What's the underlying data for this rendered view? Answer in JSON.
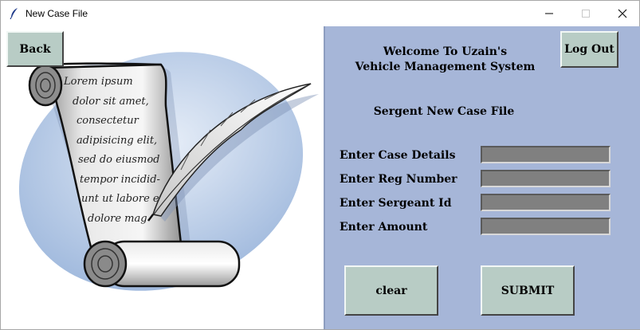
{
  "window": {
    "title": "New Case File",
    "icon": "feather-icon"
  },
  "header": {
    "back_label": "Back",
    "logout_label": "Log Out",
    "welcome_line1": "Welcome To Uzain's",
    "welcome_line2": "Vehicle Management System",
    "subheading": "Sergent New Case File"
  },
  "illustration": {
    "lines": [
      "Lorem ipsum",
      "dolor sit amet,",
      "consectetur",
      "adipisicing elit,",
      "sed do eiusmod",
      "tempor incidid-",
      "unt ut labore e",
      "dolore mag"
    ]
  },
  "form": {
    "fields": [
      {
        "label": "Enter Case Details",
        "value": ""
      },
      {
        "label": "Enter Reg Number",
        "value": ""
      },
      {
        "label": "Enter Sergeant Id",
        "value": ""
      },
      {
        "label": "Enter Amount",
        "value": ""
      }
    ],
    "clear_label": "clear",
    "submit_label": "SUBMIT"
  },
  "colors": {
    "panel_bg": "#a6b6d8",
    "button_bg": "#b8ccc5",
    "field_bg": "#808080"
  }
}
